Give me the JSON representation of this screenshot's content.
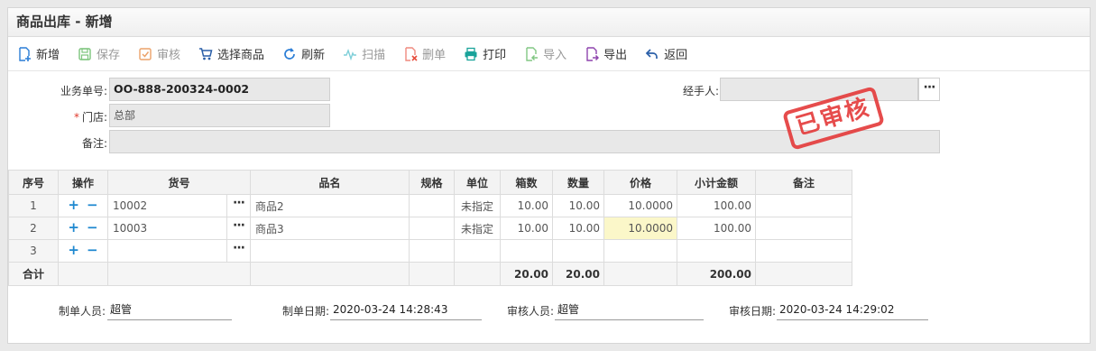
{
  "title": "商品出库 - 新增",
  "toolbar": [
    {
      "label": "新增",
      "icon": "add-doc-icon",
      "disabled": false,
      "color": "#2a7dd6"
    },
    {
      "label": "保存",
      "icon": "save-icon",
      "disabled": true,
      "color": "#5cb85c"
    },
    {
      "label": "审核",
      "icon": "audit-icon",
      "disabled": true,
      "color": "#e6873a"
    },
    {
      "label": "选择商品",
      "icon": "cart-icon",
      "disabled": false,
      "color": "#2a5fa8"
    },
    {
      "label": "刷新",
      "icon": "refresh-icon",
      "disabled": false,
      "color": "#2a7dd6"
    },
    {
      "label": "扫描",
      "icon": "scan-icon",
      "disabled": true,
      "color": "#48b8c8"
    },
    {
      "label": "删单",
      "icon": "delete-doc-icon",
      "disabled": true,
      "color": "#e74c3c"
    },
    {
      "label": "打印",
      "icon": "print-icon",
      "disabled": false,
      "color": "#1aa39a"
    },
    {
      "label": "导入",
      "icon": "import-icon",
      "disabled": true,
      "color": "#4caf50"
    },
    {
      "label": "导出",
      "icon": "export-icon",
      "disabled": false,
      "color": "#8e44ad"
    },
    {
      "label": "返回",
      "icon": "back-icon",
      "disabled": false,
      "color": "#2a5fa8"
    }
  ],
  "form": {
    "order_no_label": "业务单号:",
    "order_no": "OO-888-200324-0002",
    "store_label": "门店:",
    "store_required": "*",
    "store": "总部",
    "remark_label": "备注:",
    "remark": "",
    "handler_label": "经手人:",
    "handler": "",
    "more": "···"
  },
  "stamp": "已审核",
  "table": {
    "headers": [
      "序号",
      "操作",
      "货号",
      "品名",
      "规格",
      "单位",
      "箱数",
      "数量",
      "价格",
      "小计金额",
      "备注"
    ],
    "rows": [
      {
        "no": "1",
        "sku": "10002",
        "name": "商品2",
        "spec": "",
        "unit": "未指定",
        "boxes": "10.00",
        "qty": "10.00",
        "price": "10.0000",
        "subtotal": "100.00",
        "remark": ""
      },
      {
        "no": "2",
        "sku": "10003",
        "name": "商品3",
        "spec": "",
        "unit": "未指定",
        "boxes": "10.00",
        "qty": "10.00",
        "price": "10.0000",
        "subtotal": "100.00",
        "remark": ""
      },
      {
        "no": "3",
        "sku": "",
        "name": "",
        "spec": "",
        "unit": "",
        "boxes": "",
        "qty": "",
        "price": "",
        "subtotal": "",
        "remark": ""
      }
    ],
    "add_op": "+",
    "remove_op": "−",
    "more": "···",
    "total": {
      "label": "合计",
      "boxes": "20.00",
      "qty": "20.00",
      "subtotal": "200.00"
    }
  },
  "footer": {
    "creator_label": "制单人员:",
    "creator": "超管",
    "create_date_label": "制单日期:",
    "create_date": "2020-03-24 14:28:43",
    "auditor_label": "审核人员:",
    "auditor": "超管",
    "audit_date_label": "审核日期:",
    "audit_date": "2020-03-24 14:29:02"
  }
}
